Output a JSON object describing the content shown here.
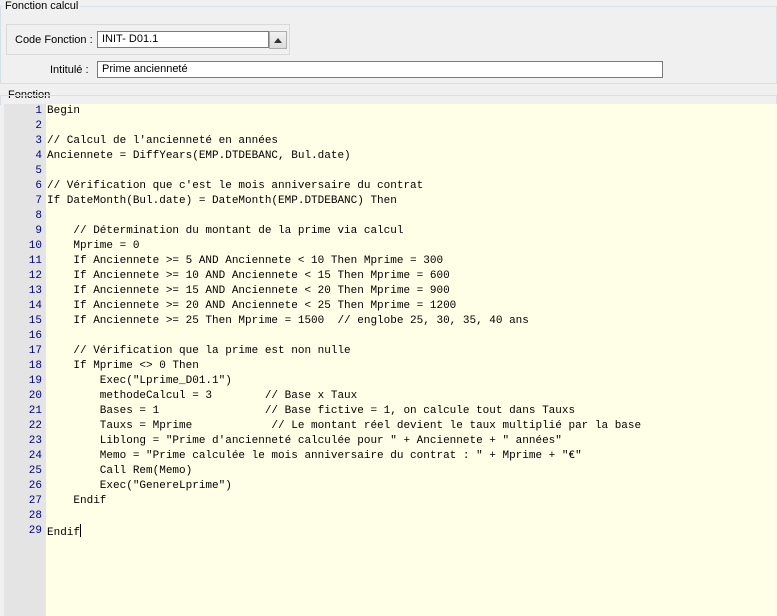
{
  "sections": {
    "fonction_calcul": "Fonction calcul",
    "fonction": "Fonction"
  },
  "fields": {
    "code_fonction_label": "Code Fonction :",
    "code_fonction_value": "INIT- D01.1",
    "intitule_label": "Intitulé :",
    "intitule_value": "Prime ancienneté"
  },
  "code_lines": [
    {
      "n": "1",
      "text": "Begin"
    },
    {
      "n": "2",
      "text": ""
    },
    {
      "n": "3",
      "text": "// Calcul de l'ancienneté en années"
    },
    {
      "n": "4",
      "text": "Anciennete = DiffYears(EMP.DTDEBANC, Bul.date)"
    },
    {
      "n": "5",
      "text": ""
    },
    {
      "n": "6",
      "text": "// Vérification que c'est le mois anniversaire du contrat"
    },
    {
      "n": "7",
      "text": "If DateMonth(Bul.date) = DateMonth(EMP.DTDEBANC) Then"
    },
    {
      "n": "8",
      "text": ""
    },
    {
      "n": "9",
      "text": "    // Détermination du montant de la prime via calcul"
    },
    {
      "n": "10",
      "text": "    Mprime = 0"
    },
    {
      "n": "11",
      "text": "    If Anciennete >= 5 AND Anciennete < 10 Then Mprime = 300"
    },
    {
      "n": "12",
      "text": "    If Anciennete >= 10 AND Anciennete < 15 Then Mprime = 600"
    },
    {
      "n": "13",
      "text": "    If Anciennete >= 15 AND Anciennete < 20 Then Mprime = 900"
    },
    {
      "n": "14",
      "text": "    If Anciennete >= 20 AND Anciennete < 25 Then Mprime = 1200"
    },
    {
      "n": "15",
      "text": "    If Anciennete >= 25 Then Mprime = 1500  // englobe 25, 30, 35, 40 ans"
    },
    {
      "n": "16",
      "text": ""
    },
    {
      "n": "17",
      "text": "    // Vérification que la prime est non nulle"
    },
    {
      "n": "18",
      "text": "    If Mprime <> 0 Then"
    },
    {
      "n": "19",
      "text": "        Exec(\"Lprime_D01.1\")"
    },
    {
      "n": "20",
      "text": "        methodeCalcul = 3        // Base x Taux"
    },
    {
      "n": "21",
      "text": "        Bases = 1                // Base fictive = 1, on calcule tout dans Tauxs"
    },
    {
      "n": "22",
      "text": "        Tauxs = Mprime            // Le montant réel devient le taux multiplié par la base"
    },
    {
      "n": "23",
      "text": "        Liblong = \"Prime d'ancienneté calculée pour \" + Anciennete + \" années\""
    },
    {
      "n": "24",
      "text": "        Memo = \"Prime calculée le mois anniversaire du contrat : \" + Mprime + \"€\""
    },
    {
      "n": "25",
      "text": "        Call Rem(Memo)"
    },
    {
      "n": "26",
      "text": "        Exec(\"GenereLprime\")"
    },
    {
      "n": "27",
      "text": "    Endif"
    },
    {
      "n": "28",
      "text": ""
    },
    {
      "n": "29",
      "text": "Endif"
    }
  ]
}
